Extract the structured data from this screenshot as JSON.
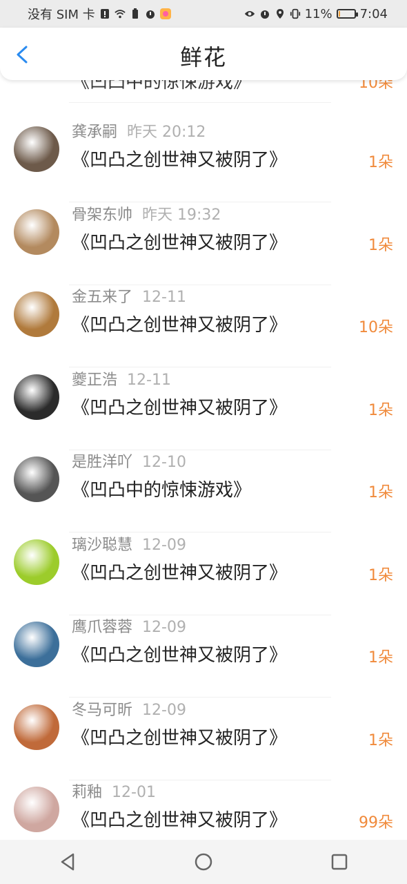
{
  "status_bar": {
    "carrier": "没有 SIM 卡",
    "battery_percent": "11%",
    "battery_level": 0.11,
    "time": "7:04",
    "icons": [
      "sim-warning-icon",
      "wifi-icon",
      "battery-saver-icon",
      "alarm-icon",
      "app-notification-icon",
      "eye-icon",
      "alarm-icon",
      "location-icon",
      "vibrate-icon",
      "battery-icon"
    ]
  },
  "header": {
    "title": "鲜花",
    "back_icon": "chevron-left-icon"
  },
  "partial_item": {
    "book": "《凹凸中的惊悚游戏》",
    "count": "10朵"
  },
  "items": [
    {
      "name": "龚承嗣",
      "time": "昨天 20:12",
      "book": "《凹凸之创世神又被阴了》",
      "count": "1朵",
      "avatar_color": "#6d5a4a"
    },
    {
      "name": "骨架东帅",
      "time": "昨天 19:32",
      "book": "《凹凸之创世神又被阴了》",
      "count": "1朵",
      "avatar_color": "#b38a5f"
    },
    {
      "name": "金五来了",
      "time": "12-11",
      "book": "《凹凸之创世神又被阴了》",
      "count": "10朵",
      "avatar_color": "#b07a3c"
    },
    {
      "name": "夔正浩",
      "time": "12-11",
      "book": "《凹凸之创世神又被阴了》",
      "count": "1朵",
      "avatar_color": "#2b2b2b"
    },
    {
      "name": "是胜洋吖",
      "time": "12-10",
      "book": "《凹凸中的惊悚游戏》",
      "count": "1朵",
      "avatar_color": "#555555"
    },
    {
      "name": "璃沙聪慧",
      "time": "12-09",
      "book": "《凹凸之创世神又被阴了》",
      "count": "1朵",
      "avatar_color": "#9ccc2b"
    },
    {
      "name": "鹰爪蓉蓉",
      "time": "12-09",
      "book": "《凹凸之创世神又被阴了》",
      "count": "1朵",
      "avatar_color": "#3c6f9a"
    },
    {
      "name": "冬马可昕",
      "time": "12-09",
      "book": "《凹凸之创世神又被阴了》",
      "count": "1朵",
      "avatar_color": "#c06a3a"
    },
    {
      "name": "莉釉",
      "time": "12-01",
      "book": "《凹凸之创世神又被阴了》",
      "count": "99朵",
      "avatar_color": "#cfa7a0"
    }
  ],
  "nav": {
    "back": "back-triangle-icon",
    "home": "home-circle-icon",
    "recents": "recents-square-icon"
  },
  "colors": {
    "accent": "#f08a3b",
    "back_arrow": "#2a8bf0"
  }
}
